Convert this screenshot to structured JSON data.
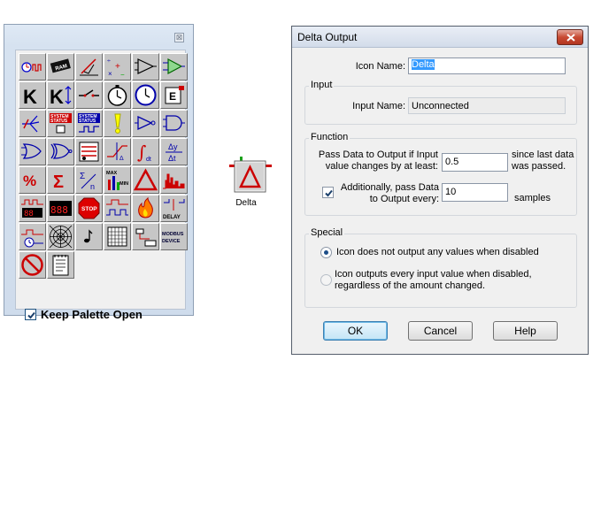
{
  "palette": {
    "close_glyph": "⊠",
    "keep_open_label": "Keep Palette Open",
    "keep_open_checked": true,
    "tiles": [
      {
        "name": "clock-wave-icon"
      },
      {
        "name": "ram-chip-icon"
      },
      {
        "name": "needle-gauge-icon"
      },
      {
        "name": "math-operators-icon"
      },
      {
        "name": "comparator-icon"
      },
      {
        "name": "comparator-green-icon"
      },
      {
        "name": "constant-k-icon"
      },
      {
        "name": "variable-k-icon"
      },
      {
        "name": "switch-icon"
      },
      {
        "name": "stopwatch-icon"
      },
      {
        "name": "clock-icon"
      },
      {
        "name": "counter-e-icon"
      },
      {
        "name": "signal-splitter-icon"
      },
      {
        "name": "system-status-icon"
      },
      {
        "name": "system-status-pulse-icon"
      },
      {
        "name": "exclamation-icon"
      },
      {
        "name": "buffer-gate-icon"
      },
      {
        "name": "and-gate-icon"
      },
      {
        "name": "or-gate-icon"
      },
      {
        "name": "xor-gate-icon"
      },
      {
        "name": "sequence-icon"
      },
      {
        "name": "derivative-icon"
      },
      {
        "name": "integral-icon"
      },
      {
        "name": "delta-ratio-icon"
      },
      {
        "name": "percent-icon"
      },
      {
        "name": "sum-icon"
      },
      {
        "name": "average-icon"
      },
      {
        "name": "max-min-icon"
      },
      {
        "name": "delta-icon"
      },
      {
        "name": "histogram-icon"
      },
      {
        "name": "digital-display-icon"
      },
      {
        "name": "seven-segment-icon"
      },
      {
        "name": "stop-sign-icon"
      },
      {
        "name": "timing-icon"
      },
      {
        "name": "alarm-flame-icon"
      },
      {
        "name": "delay-icon"
      },
      {
        "name": "flow-icon"
      },
      {
        "name": "web-icon"
      },
      {
        "name": "music-note-icon"
      },
      {
        "name": "table-grid-icon"
      },
      {
        "name": "io-device-icon"
      },
      {
        "name": "modbus-device-icon"
      },
      {
        "name": "no-entry-gauge-icon"
      },
      {
        "name": "notepad-icon"
      }
    ],
    "text_tiles": {
      "ram": "RAM",
      "k": "K",
      "e": "E",
      "system": "SYSTEM",
      "status": "STATUS",
      "stop": "STOP",
      "max": "MAX",
      "min": "MIN",
      "delay": "DELAY",
      "modbus": "MODBUS",
      "device": "DEVICE",
      "percent": "%",
      "sigma": "Σ",
      "n": "n",
      "dt": "dt",
      "delta_y": "Δy",
      "delta_t": "Δt"
    }
  },
  "delta_icon": {
    "caption": "Delta"
  },
  "dialog": {
    "title": "Delta Output",
    "icon_name_label": "Icon Name:",
    "icon_name_value": "Delta",
    "input_group": "Input",
    "input_name_label": "Input Name:",
    "input_name_value": "Unconnected",
    "function_group": "Function",
    "pass_label_1": "Pass Data to Output if Input",
    "pass_label_2": "value changes by at least:",
    "pass_value": "0.5",
    "since_label_1": "since last data",
    "since_label_2": "was passed.",
    "additionally_label_1": "Additionally, pass Data",
    "additionally_label_2": "to Output every:",
    "additionally_checked": true,
    "additionally_value": "10",
    "samples_label": "samples",
    "special_group": "Special",
    "radio_1_label": "Icon does not output any values when disabled",
    "radio_2_label_1": "Icon outputs every input value when disabled,",
    "radio_2_label_2": "regardless of the amount changed.",
    "ok_label": "OK",
    "cancel_label": "Cancel",
    "help_label": "Help"
  },
  "colors": {
    "accent_selection": "#3399ff",
    "close_button": "#c84a33"
  }
}
